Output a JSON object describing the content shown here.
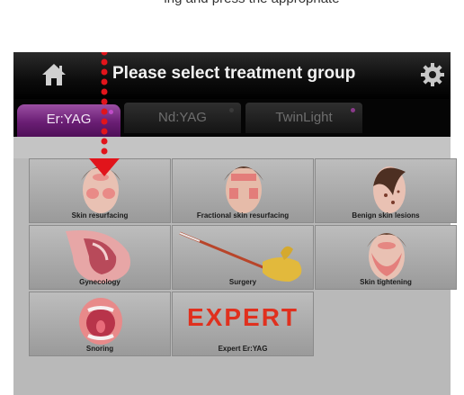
{
  "caption": "ing and press the appropriate",
  "header": {
    "title": "Please select treatment group",
    "home_icon": "home-icon",
    "settings_icon": "gear-icon"
  },
  "tabs": [
    {
      "label": "Er:YAG",
      "active": true,
      "dot_color": "#c04cc8"
    },
    {
      "label": "Nd:YAG",
      "active": false,
      "dot_color": "#3a3a3a"
    },
    {
      "label": "TwinLight",
      "active": false,
      "dot_color": "#8a3a8a"
    }
  ],
  "tiles": [
    {
      "label": "Skin resurfacing",
      "icon": "face-icon"
    },
    {
      "label": "Fractional skin resurfacing",
      "icon": "face-fractional-icon"
    },
    {
      "label": "Benign skin lesions",
      "icon": "face-lesions-icon"
    },
    {
      "label": "Gynecology",
      "icon": "anatomy-icon"
    },
    {
      "label": "Surgery",
      "icon": "scalpel-icon"
    },
    {
      "label": "Skin tightening",
      "icon": "face-tightening-icon"
    },
    {
      "label": "Snoring",
      "icon": "mouth-icon"
    },
    {
      "label": "Expert Er:YAG",
      "icon": "expert-logo",
      "logo_text": "EXPERT"
    }
  ],
  "annotation": {
    "color": "#e1141b"
  }
}
